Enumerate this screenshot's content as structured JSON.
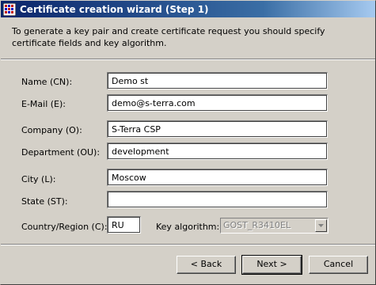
{
  "window": {
    "title": "Certificate creation wizard (Step 1)"
  },
  "header": {
    "description": "To generate a key pair and create certificate request you should specify certificate fields and key algorithm."
  },
  "form": {
    "name": {
      "label": "Name (CN):",
      "value": "Demo st"
    },
    "email": {
      "label": "E-Mail (E):",
      "value": "demo@s-terra.com"
    },
    "company": {
      "label": "Company (O):",
      "value": "S-Terra CSP"
    },
    "department": {
      "label": "Department (OU):",
      "value": "development"
    },
    "city": {
      "label": "City (L):",
      "value": "Moscow"
    },
    "state": {
      "label": "State (ST):",
      "value": ""
    },
    "country": {
      "label": "Country/Region (C):",
      "value": "RU"
    },
    "key_algorithm": {
      "label": "Key algorithm:",
      "value": "GOST_R3410EL"
    }
  },
  "buttons": {
    "back": "< Back",
    "next": "Next >",
    "cancel": "Cancel"
  },
  "icons": {
    "app": "certificate-wizard-icon",
    "dropdown": "chevron-down-icon"
  },
  "colors": {
    "titlebar_start": "#0a246a",
    "titlebar_end": "#a6caf0",
    "face": "#d4d0c8"
  }
}
